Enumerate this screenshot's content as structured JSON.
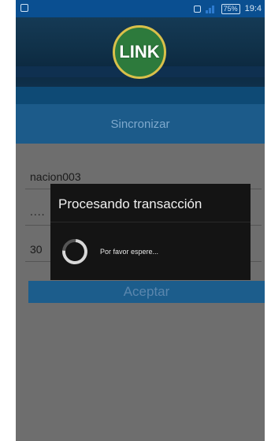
{
  "status_bar": {
    "battery": "75%",
    "time": "19:4"
  },
  "header": {
    "logo_text": "LINK",
    "title": "Sincronizar"
  },
  "form": {
    "user_value": "nacion003",
    "password_value": "....",
    "code_value": "30",
    "accept_label": "Aceptar"
  },
  "dialog": {
    "title": "Procesando transacción",
    "message": "Por favor espere..."
  },
  "colors": {
    "status_bar": "#0a4f91",
    "header": "#103149",
    "sync_bar": "#1c5b8a",
    "logo_green": "#2d7a3c",
    "logo_ring": "#d9c04a",
    "dialog_bg": "#141414"
  }
}
